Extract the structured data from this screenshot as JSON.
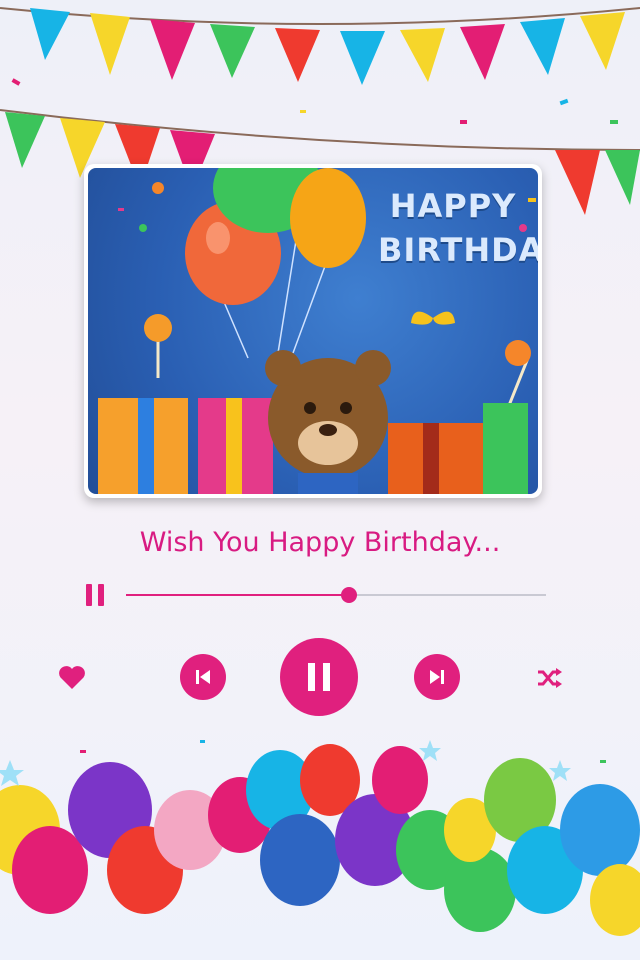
{
  "card": {
    "title_line1": "HAPPY",
    "title_line2": "BIRTHDAY!"
  },
  "player": {
    "song_title": "Wish You Happy Birthday...",
    "progress": 0.53,
    "state": "playing"
  },
  "icons": {
    "mini_pause": "pause-icon",
    "favorite": "heart-icon",
    "previous": "skip-previous-icon",
    "play_pause": "pause-icon",
    "next": "skip-next-icon",
    "shuffle": "shuffle-icon"
  },
  "colors": {
    "accent": "#e0207e",
    "card_bg": "#2a5fb3"
  }
}
